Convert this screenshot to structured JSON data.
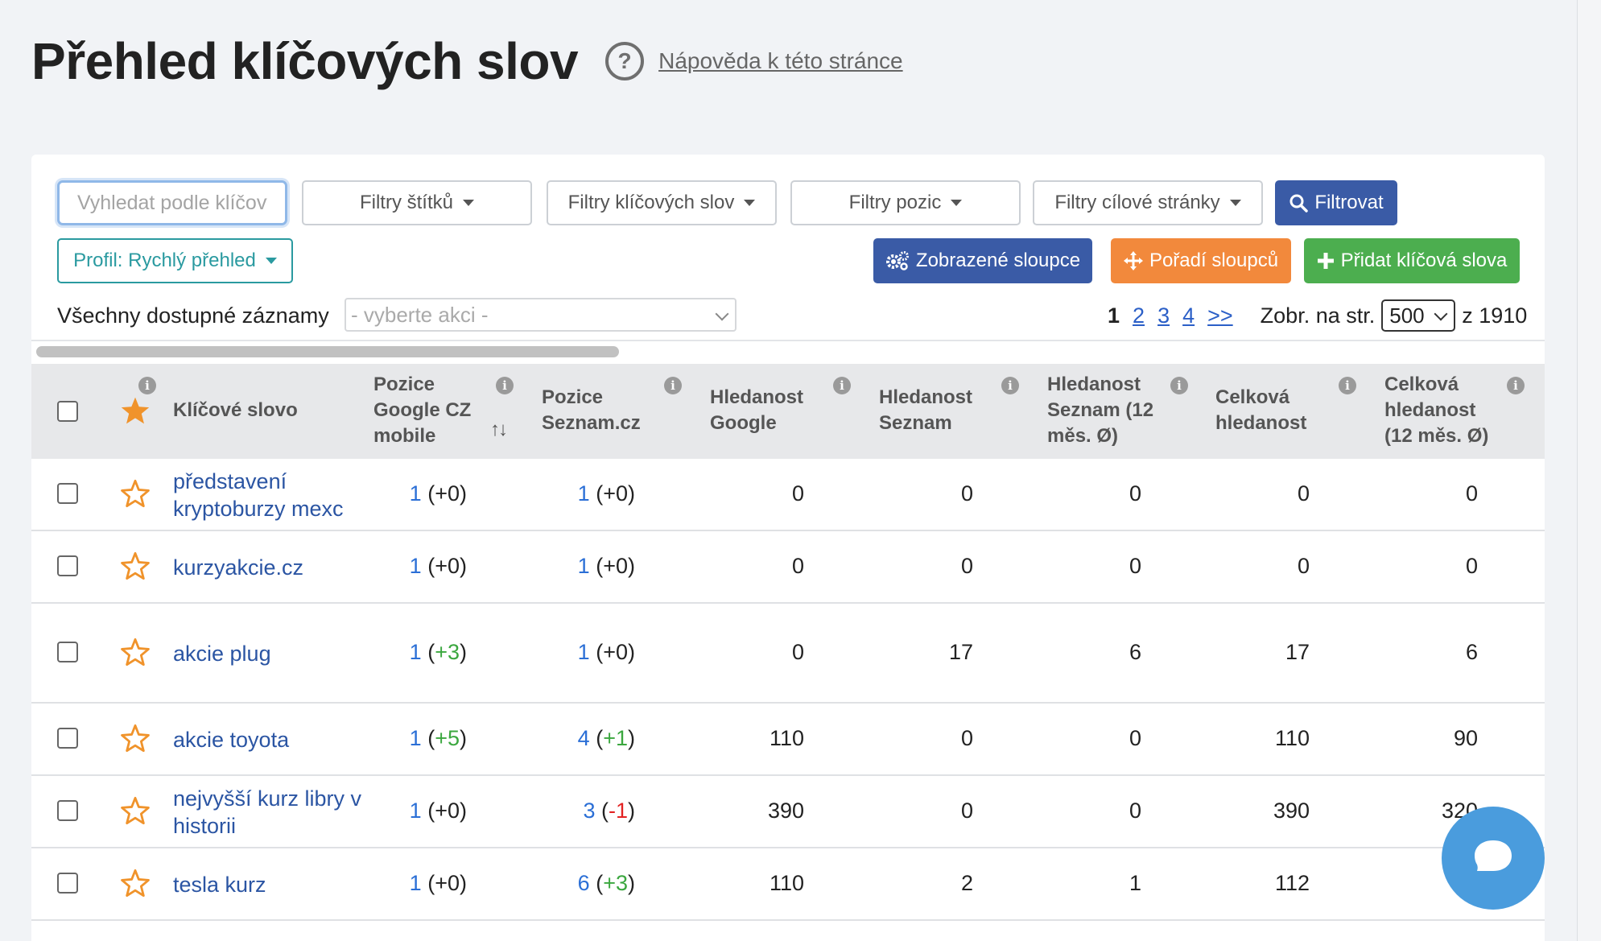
{
  "page": {
    "title": "Přehled klíčových slov",
    "help_link": "Nápověda k této stránce",
    "help_glyph": "?"
  },
  "toolbar": {
    "search_placeholder": "Vyhledat podle klíčových slov",
    "filters": [
      "Filtry štítků",
      "Filtry klíčových slov",
      "Filtry pozic",
      "Filtry cílové stránky"
    ],
    "filter_button": "Filtrovat",
    "profile": "Profil: Rychlý přehled",
    "columns_button": "Zobrazené sloupce",
    "order_button": "Pořadí sloupců",
    "add_button": "Přidat klíčová slova",
    "records_label": "Všechny dostupné záznamy",
    "action_placeholder": "- vyberte akci -"
  },
  "pager": {
    "current": "1",
    "pages": [
      "2",
      "3",
      "4",
      ">>"
    ],
    "per_page_label": "Zobr. na str.",
    "per_page": "500",
    "total": "z 1910"
  },
  "table": {
    "headers": {
      "keyword": "Klíčové slovo",
      "google_pos": "Pozice Google CZ mobile",
      "seznam_pos": "Pozice Seznam.cz",
      "google_search": "Hledanost Google",
      "seznam_search": "Hledanost Seznam",
      "seznam_12m": "Hledanost Seznam (12 měs. Ø)",
      "total_search": "Celková hledanost",
      "total_12m": "Celková hledanost (12 měs. Ø)"
    },
    "sort_glyph": "↑↓",
    "info_glyph": "i",
    "rows": [
      {
        "keyword": "představení kryptoburzy mexc",
        "g_pos": "1",
        "g_delta": "+0",
        "s_pos": "1",
        "s_delta": "+0",
        "g_search": "0",
        "s_search": "0",
        "s_12m": "0",
        "total": "0",
        "total_12m": "0"
      },
      {
        "keyword": "kurzyakcie.cz",
        "g_pos": "1",
        "g_delta": "+0",
        "s_pos": "1",
        "s_delta": "+0",
        "g_search": "0",
        "s_search": "0",
        "s_12m": "0",
        "total": "0",
        "total_12m": "0"
      },
      {
        "keyword": "akcie plug",
        "g_pos": "1",
        "g_delta": "+3",
        "s_pos": "1",
        "s_delta": "+0",
        "g_search": "0",
        "s_search": "17",
        "s_12m": "6",
        "total": "17",
        "total_12m": "6"
      },
      {
        "keyword": "akcie toyota",
        "g_pos": "1",
        "g_delta": "+5",
        "s_pos": "4",
        "s_delta": "+1",
        "g_search": "110",
        "s_search": "0",
        "s_12m": "0",
        "total": "110",
        "total_12m": "90"
      },
      {
        "keyword": "nejvyšší kurz libry v historii",
        "g_pos": "1",
        "g_delta": "+0",
        "s_pos": "3",
        "s_delta": "-1",
        "g_search": "390",
        "s_search": "0",
        "s_12m": "0",
        "total": "390",
        "total_12m": "320"
      },
      {
        "keyword": "tesla kurz",
        "g_pos": "1",
        "g_delta": "+0",
        "s_pos": "6",
        "s_delta": "+3",
        "g_search": "110",
        "s_search": "2",
        "s_12m": "1",
        "total": "112",
        "total_12m": ""
      }
    ]
  },
  "colors": {
    "primary": "#3a5ba6",
    "orange": "#f2893c",
    "green": "#4cae4f",
    "teal": "#2a9aa0",
    "link": "#2b55a3",
    "positive": "#3ba73f",
    "negative": "#e32323",
    "star": "#f0932b",
    "chat": "#4a9cdd"
  },
  "icons": {
    "search_button": "search-icon",
    "columns_button": "gears-icon",
    "order_button": "move-arrows-icon",
    "add_button": "plus-icon",
    "favorite": "star-icon",
    "chat": "chat-bubble-icon"
  }
}
